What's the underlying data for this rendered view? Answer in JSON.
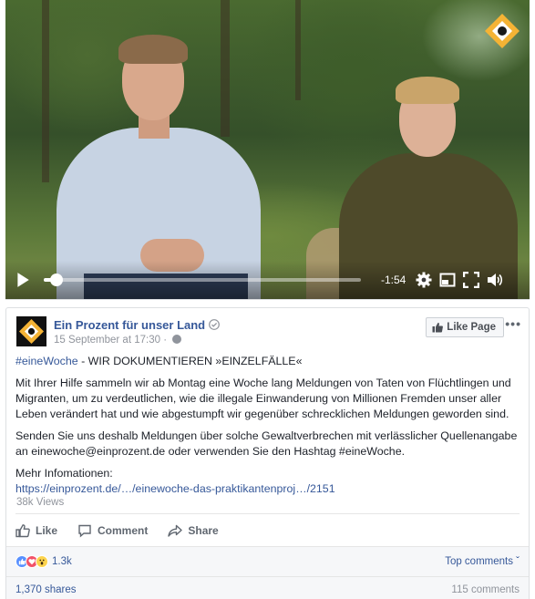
{
  "video": {
    "time_remaining": "-1:54",
    "progress": 0.04
  },
  "post": {
    "page_name": "Ein Prozent für unser Land",
    "timestamp": "15 September at 17:30",
    "separator": " · ",
    "like_page_label": "Like Page",
    "more_label": "•••",
    "hashtag": "#eineWoche",
    "headline_rest": " - WIR DOKUMENTIEREN »EINZELFÄLLE«",
    "paragraph_1": "Mit Ihrer Hilfe sammeln wir ab Montag eine Woche lang Meldungen von Taten von Flüchtlingen und Migranten, um zu verdeutlichen, wie die illegale Einwanderung von Millionen Fremden unser aller Leben verändert hat und wie abgestumpft wir gegenüber schrecklichen Meldungen geworden sind.",
    "paragraph_2": "Senden Sie uns deshalb Meldungen über solche Gewaltverbrechen mit verlässlicher Quellenangabe an einewoche@einprozent.de oder verwenden Sie den Hashtag #eineWoche.",
    "more_info_label": "Mehr Infomationen:",
    "link": "https://einprozent.de/…/einewoche-das-praktikantenproj…/2151",
    "views": "38k Views"
  },
  "actions": {
    "like": "Like",
    "comment": "Comment",
    "share": "Share"
  },
  "stats": {
    "reactions_count": "1.3k",
    "top_comments": "Top comments ˇ",
    "shares": "1,370 shares",
    "comments": "115 comments"
  },
  "colors": {
    "link": "#365899",
    "brand_yellow": "#f5b335",
    "like_blue": "#5890ff",
    "love_red": "#f25268"
  }
}
